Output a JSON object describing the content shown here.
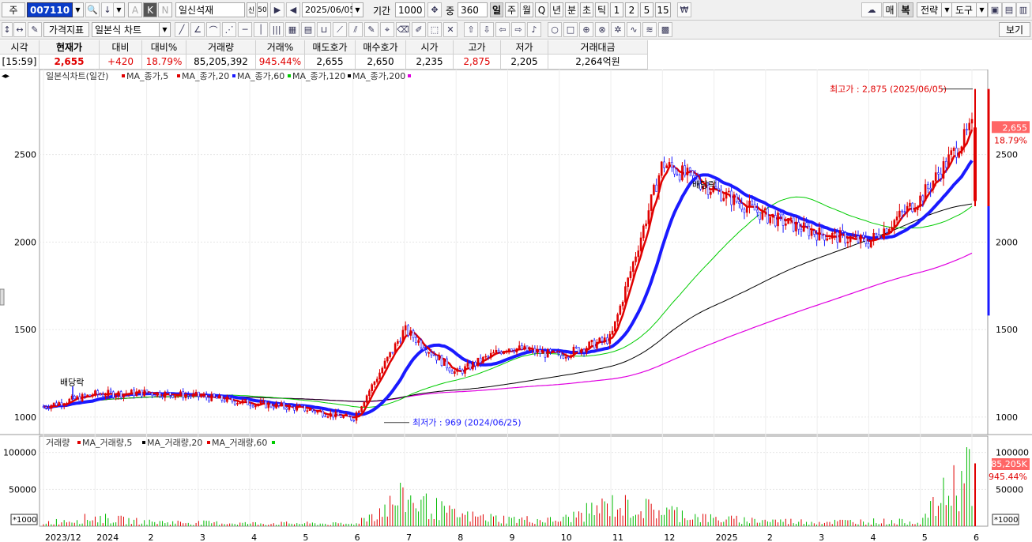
{
  "toolbar1": {
    "market_label": "주",
    "stock_code": "007110",
    "stock_name": "일신석재",
    "name_badge_a": "신",
    "name_badge_b": "50",
    "date": "2025/06/05",
    "period_label": "기간",
    "period_value": "1000",
    "overlap_label": "중",
    "overlap_value": "360",
    "btn_a": "A",
    "btn_k": "K",
    "btn_n": "N",
    "timeframes": [
      "일",
      "주",
      "월",
      "Q",
      "년",
      "분",
      "초",
      "틱",
      "1",
      "2",
      "5",
      "15"
    ],
    "timeframe_selected": "일",
    "right_buttons": [
      "매",
      "복",
      "전략",
      "도구"
    ]
  },
  "toolbar2": {
    "chart_type_label": "가격지표",
    "chart_style": "일본식 차트",
    "view_button": "보기"
  },
  "quote": {
    "headers": [
      "시각",
      "현재가",
      "대비",
      "대비%",
      "거래량",
      "거래%",
      "매도호가",
      "매수호가",
      "시가",
      "고가",
      "저가",
      "거래대금"
    ],
    "values": [
      "[15:59]",
      "2,655",
      "+420",
      "18.79%",
      "85,205,392",
      "945.44%",
      "2,655",
      "2,650",
      "2,235",
      "2,875",
      "2,205",
      "2,264억원"
    ]
  },
  "price_legend": {
    "title": "일본식차트(일간)",
    "items": [
      "MA_종가,5",
      "MA_종가,20",
      "MA_종가,60",
      "MA_종가,120",
      "MA_종가,200"
    ],
    "colors": [
      "#e00000",
      "#e00000",
      "#1a1aff",
      "#00cc00",
      "#000000",
      "#e000e0"
    ]
  },
  "volume_legend": {
    "title": "거래량",
    "items": [
      "MA_거래량,5",
      "MA_거래량,20",
      "MA_거래량,60"
    ],
    "colors": [
      "#e00000",
      "#000000",
      "#e00000",
      "#00cc00"
    ]
  },
  "annotations": {
    "high": "최고가 : 2,875 (2025/06/05)",
    "low": "최저가 : 969 (2024/06/25)",
    "dividend1": "배당락",
    "dividend2": "배당락"
  },
  "price_axis_ticks": [
    "2500",
    "2000",
    "1500",
    "1000"
  ],
  "volume_axis_ticks": [
    "100000",
    "50000"
  ],
  "volume_unit": "*1000",
  "current_price_tag": "2,655",
  "current_change_tag": "18.79%",
  "current_volume_tag": "85,205K",
  "current_volume_pct_tag": "945.44%",
  "x_axis_labels": [
    "2023/12",
    "2024",
    "2",
    "3",
    "4",
    "5",
    "6",
    "7",
    "8",
    "9",
    "10",
    "11",
    "12",
    "2025",
    "2",
    "3",
    "4",
    "5",
    "6"
  ],
  "chart_data": {
    "type": "candlestick",
    "x": [
      "2023/12",
      "2024/01",
      "2024/02",
      "2024/03",
      "2024/04",
      "2024/05",
      "2024/06",
      "2024/07",
      "2024/08",
      "2024/09",
      "2024/10",
      "2024/11",
      "2024/12",
      "2025/01",
      "2025/02",
      "2025/03",
      "2025/04",
      "2025/05",
      "2025/06"
    ],
    "price_close_approx": [
      1060,
      1130,
      1140,
      1120,
      1080,
      1050,
      990,
      1500,
      1250,
      1400,
      1350,
      1450,
      2450,
      2300,
      2150,
      2050,
      2000,
      2250,
      2655
    ],
    "ma60_approx": [
      1060,
      1150,
      1180,
      1120,
      1080,
      1060,
      1040,
      1200,
      1450,
      1400,
      1380,
      1380,
      1800,
      2250,
      2150,
      2100,
      1950,
      2250,
      2200
    ],
    "volume_approx": [
      5000,
      12000,
      6000,
      5000,
      4000,
      4000,
      3000,
      40000,
      15000,
      10000,
      8000,
      30000,
      22000,
      10000,
      8000,
      6000,
      7000,
      6000,
      85205
    ],
    "price_ylim": [
      900,
      2950
    ],
    "volume_ylim": [
      0,
      120000
    ],
    "high": {
      "value": 2875,
      "date": "2025/06/05"
    },
    "low": {
      "value": 969,
      "date": "2024/06/25"
    }
  }
}
